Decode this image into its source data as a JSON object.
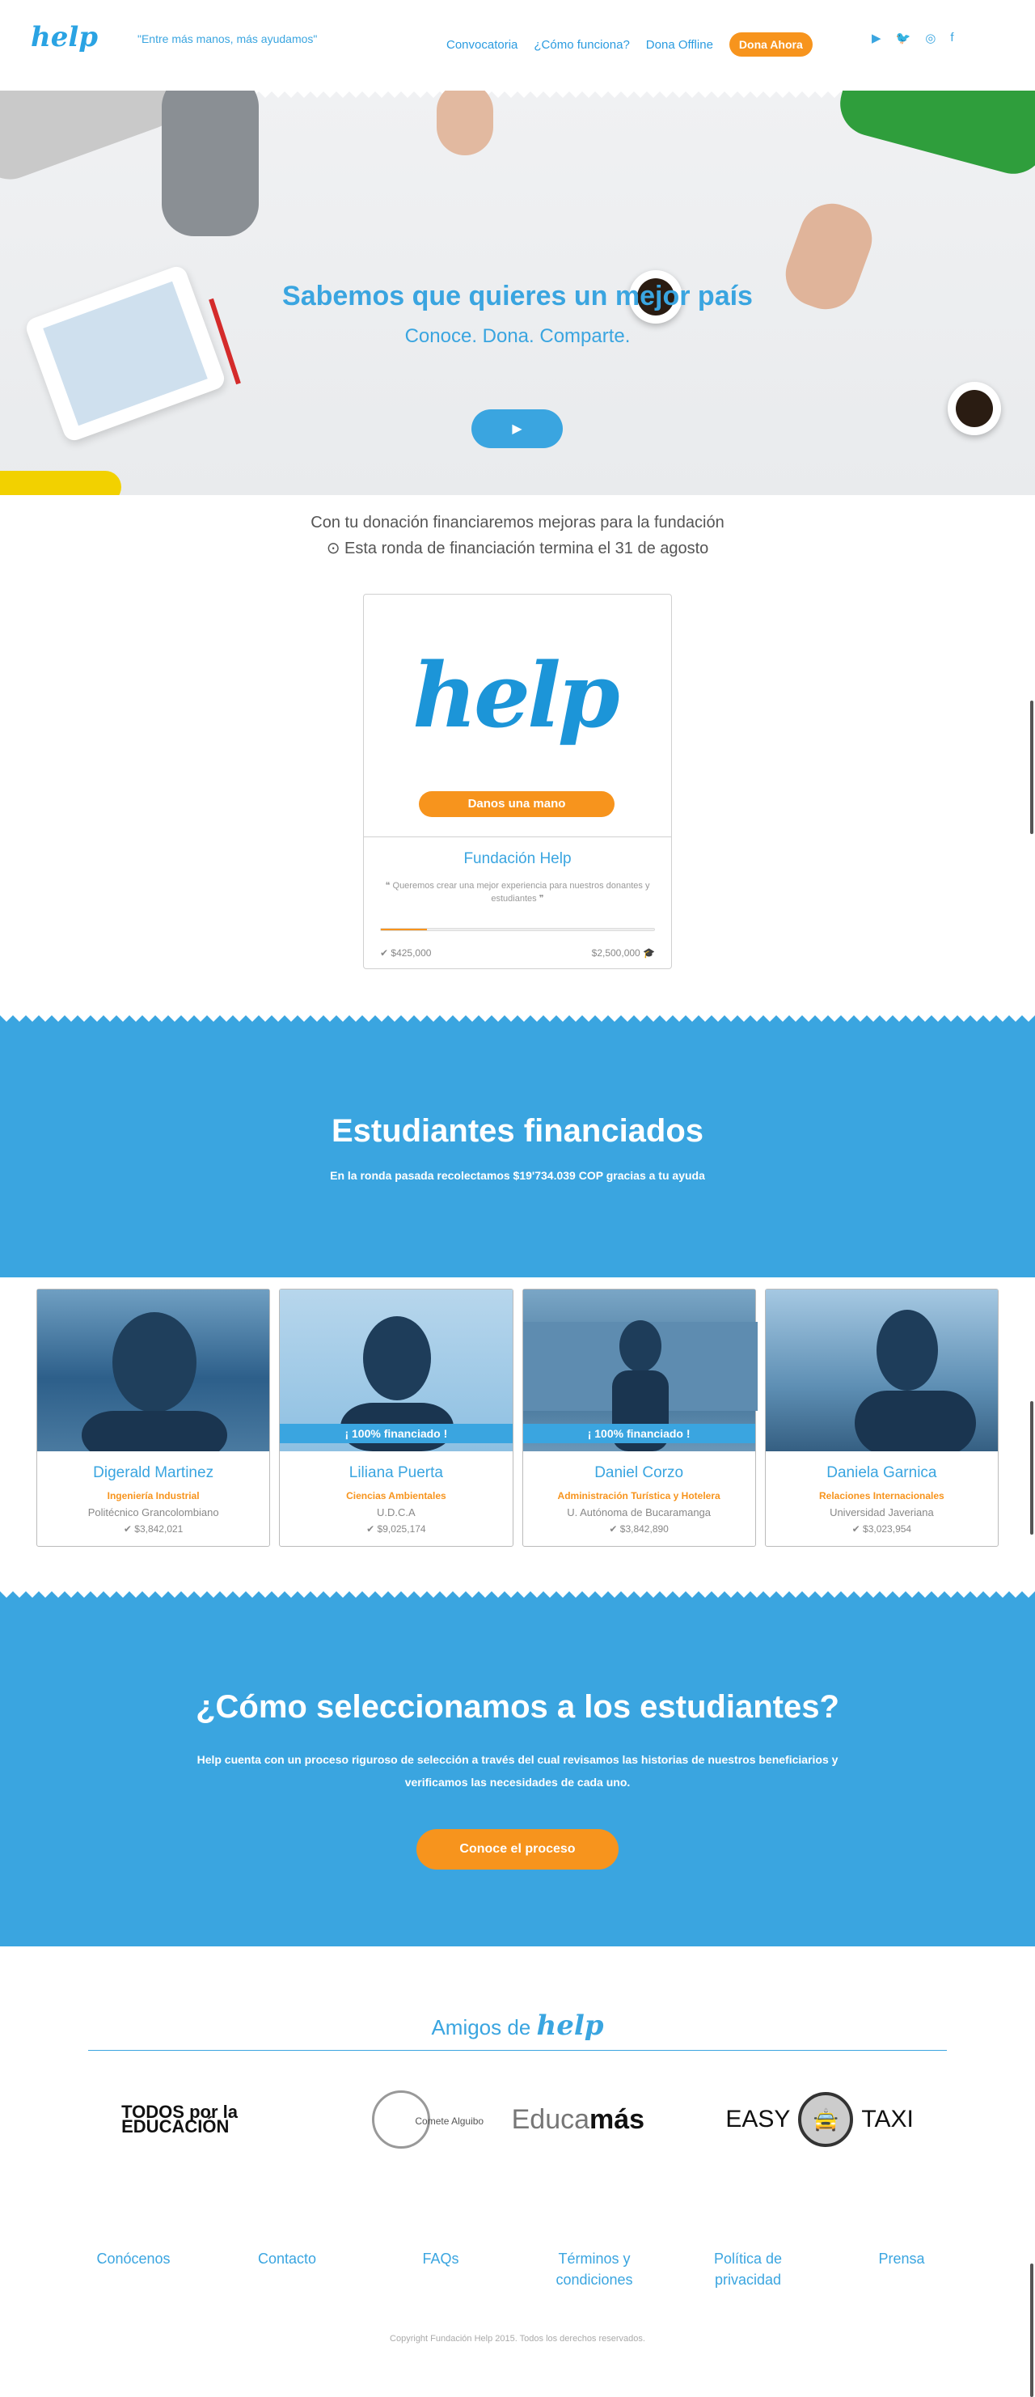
{
  "header": {
    "logo": "help",
    "slogan": "\"Entre más manos, más ayudamos\"",
    "nav": [
      "Convocatoria",
      "¿Cómo funciona?",
      "Dona Offline"
    ],
    "donate_label": "Dona Ahora"
  },
  "hero": {
    "title": "Sabemos que quieres un mejor país",
    "subtitle": "Conoce. Dona. Comparte."
  },
  "donation": {
    "line1": "Con tu donación financiaremos mejoras para la fundación",
    "line2": "⊙ Esta ronda de financiación termina el 31 de agosto",
    "card": {
      "logo": "help",
      "button": "Danos una mano",
      "title": "Fundación Help",
      "quote": "❝ Queremos crear una mejor experiencia para nuestros donantes y estudiantes ❞",
      "progress": 0.17,
      "raised": "✔ $425,000",
      "goal": "$2,500,000 🎓"
    }
  },
  "funded": {
    "title": "Estudiantes financiados",
    "text": "En la ronda pasada recolectamos $19'734.039 COP gracias a tu ayuda",
    "students": [
      {
        "name": "Digerald Martinez",
        "career": "Ingeniería Industrial",
        "uni": "Politécnico Grancolombiano",
        "amount": "✔ $3,842,021",
        "badge": ""
      },
      {
        "name": "Liliana Puerta",
        "career": "Ciencias Ambientales",
        "uni": "U.D.C.A",
        "amount": "✔ $9,025,174",
        "badge": "¡ 100% financiado !"
      },
      {
        "name": "Daniel Corzo",
        "career": "Administración Turística y Hotelera",
        "uni": "U. Autónoma de Bucaramanga",
        "amount": "✔ $3,842,890",
        "badge": "¡ 100% financiado !"
      },
      {
        "name": "Daniela Garnica",
        "career": "Relaciones Internacionales",
        "uni": "Universidad Javeriana",
        "amount": "✔ $3,023,954",
        "badge": ""
      }
    ]
  },
  "selection": {
    "title": "¿Cómo seleccionamos a los estudiantes?",
    "text": "Help cuenta con un proceso riguroso de selección a través del cual revisamos las historias de nuestros beneficiarios y verificamos las necesidades de cada uno.",
    "button": "Conoce el proceso"
  },
  "friends": {
    "title": "Amigos de",
    "title_logo": "help",
    "logos": {
      "todos": "TODOS por la EDUCACIÓN",
      "comete": "Comete Alguibo",
      "educa_light": "Educa",
      "educa_bold": "más",
      "easy_left": "EASY",
      "easy_right": "TAXI"
    }
  },
  "footer": {
    "links": [
      "Conócenos",
      "Contacto",
      "FAQs",
      "Términos y condiciones",
      "Política de privacidad",
      "Prensa"
    ],
    "copyright": "Copyright Fundación Help 2015. Todos los derechos reservados."
  },
  "colors": {
    "primary": "#3aa5e0",
    "accent": "#f7941d"
  }
}
